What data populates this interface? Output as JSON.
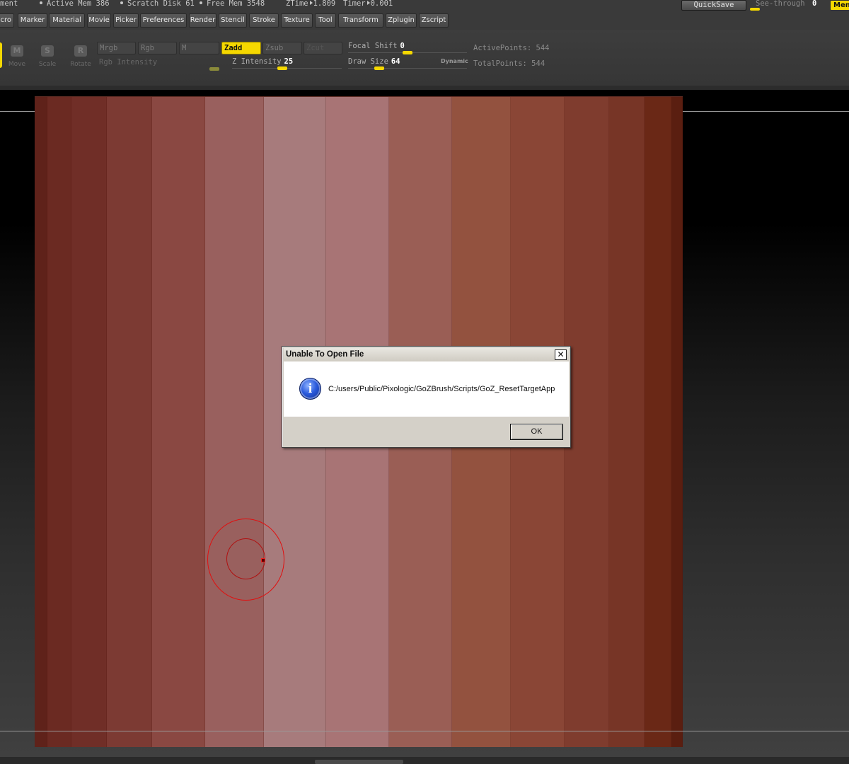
{
  "status_bar": {
    "left_fragment": "ment",
    "active_mem_label": "Active Mem",
    "active_mem_value": "386",
    "scratch_disk_label": "Scratch Disk",
    "scratch_disk_value": "61",
    "free_mem_label": "Free Mem",
    "free_mem_value": "3548",
    "ztime_label": "ZTime",
    "ztime_value": "1.809",
    "timer_label": "Timer",
    "timer_value": "0.001",
    "quicksave_label": "QuickSave",
    "see_through_label": "See-through",
    "see_through_value": "0",
    "see_through_level": 0,
    "menus_label": "Menus"
  },
  "menu_bar": {
    "items": [
      "cro",
      "Marker",
      "Material",
      "Movie",
      "Picker",
      "Preferences",
      "Render",
      "Stencil",
      "Stroke",
      "Texture",
      "Tool",
      "Transform",
      "Zplugin",
      "Zscript"
    ]
  },
  "shelf": {
    "tools": {
      "move": "Move",
      "scale": "Scale",
      "rotate": "Rotate"
    },
    "tool_icons": {
      "move": "M",
      "scale": "S",
      "rotate": "R"
    },
    "color_buttons": {
      "mrgb": "Mrgb",
      "rgb": "Rgb",
      "m": "M"
    },
    "rgb_intensity_label": "Rgb Intensity",
    "z_buttons": {
      "zadd": "Zadd",
      "zsub": "Zsub",
      "zcut": "Zcut"
    },
    "z_intensity_label": "Z Intensity",
    "z_intensity_value": "25",
    "focal_shift_label": "Focal Shift",
    "focal_shift_value": "0",
    "draw_size_label": "Draw Size",
    "draw_size_value": "64",
    "dynamic_label": "Dynamic",
    "active_points": "ActivePoints: 544",
    "total_points": "TotalPoints: 544"
  },
  "canvas": {
    "stripe_colors": [
      "#5f221a",
      "#6b2a22",
      "#702e27",
      "#7c3a33",
      "#8a4842",
      "#99605e",
      "#a77b7c",
      "#a87475",
      "#9a5e55",
      "#93523f",
      "#8a4636",
      "#7f3c2e",
      "#773526",
      "#6a2816",
      "#5a1e10"
    ]
  },
  "dialog": {
    "title": "Unable To Open File",
    "close_glyph": "✕",
    "info_glyph": "i",
    "message": "C:/users/Public/Pixologic/GoZBrush/Scripts/GoZ_ResetTargetApp",
    "ok_label": "OK"
  }
}
